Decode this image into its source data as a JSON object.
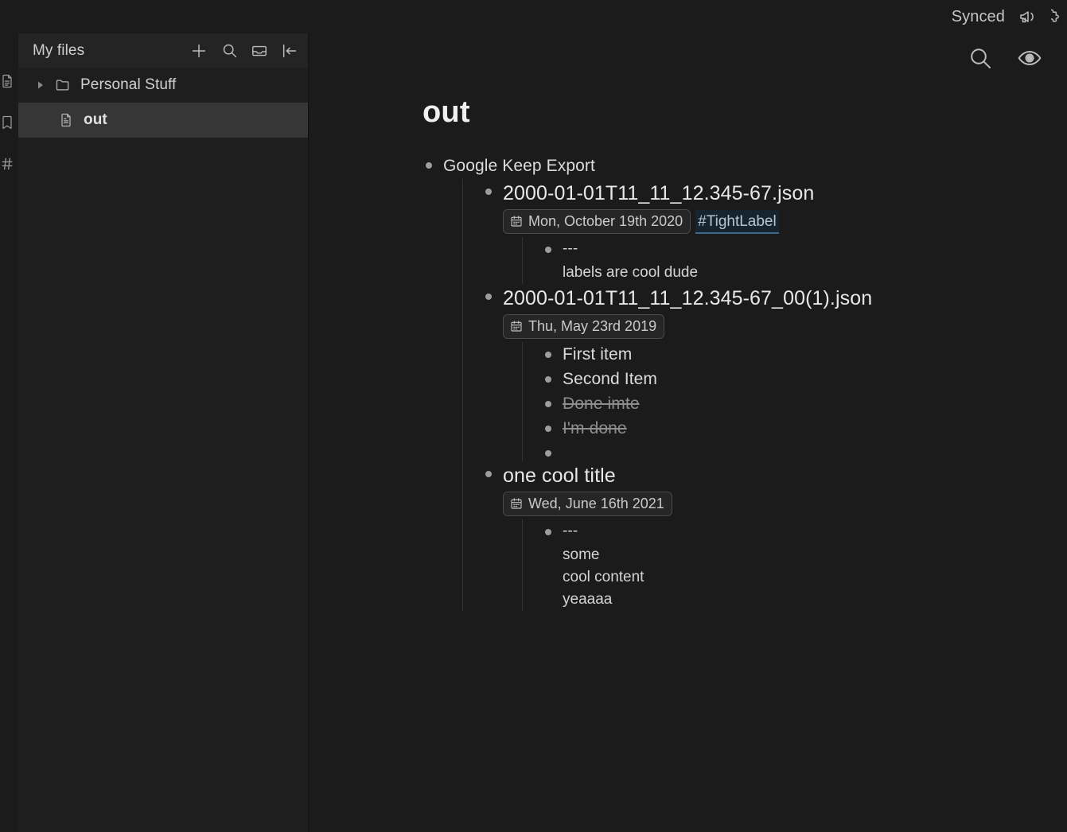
{
  "titlebar": {
    "sync_status": "Synced",
    "announcement_icon": "megaphone-icon",
    "edge_icon": "puzzle-icon"
  },
  "ribbon": {
    "items": [
      {
        "icon": "file-document-icon",
        "name": "files"
      },
      {
        "icon": "bookmark-icon",
        "name": "bookmarks"
      },
      {
        "icon": "hash-tag-icon",
        "name": "tags"
      }
    ]
  },
  "sidebar": {
    "title": "My files",
    "actions": [
      {
        "icon": "plus-icon",
        "label": "New note"
      },
      {
        "icon": "search-icon",
        "label": "Search"
      },
      {
        "icon": "archive-tray-icon",
        "label": "Archive"
      },
      {
        "icon": "collapse-sidebar-icon",
        "label": "Collapse"
      }
    ],
    "tree": [
      {
        "type": "folder",
        "label": "Personal Stuff",
        "expanded": false,
        "active": false
      },
      {
        "type": "file",
        "label": "out",
        "active": true
      }
    ]
  },
  "main": {
    "toolbar": [
      {
        "icon": "search-icon",
        "label": "Search in file"
      },
      {
        "icon": "eye-icon",
        "label": "Reading view"
      }
    ],
    "doc_title": "out",
    "outline": {
      "root_label": "Google Keep Export",
      "notes": [
        {
          "title": "2000-01-01T11_11_12.345-67.json",
          "date": "Mon, October 19th 2020",
          "tag": "#TightLabel",
          "items": [
            {
              "text": "---",
              "done": false
            }
          ],
          "body_lines": [
            "labels are cool dude"
          ]
        },
        {
          "title": "2000-01-01T11_11_12.345-67_00(1).json",
          "date": "Thu, May 23rd 2019",
          "tag": "",
          "items": [
            {
              "text": "First item",
              "done": false
            },
            {
              "text": "Second Item",
              "done": false
            },
            {
              "text": "Done imte",
              "done": true
            },
            {
              "text": "I'm  done",
              "done": true
            },
            {
              "text": "",
              "done": false
            }
          ],
          "body_lines": []
        },
        {
          "title": "one cool title",
          "date": "Wed, June 16th 2021",
          "tag": "",
          "items": [
            {
              "text": "---",
              "done": false
            }
          ],
          "body_lines": [
            "some",
            "cool content",
            "yeaaaa"
          ]
        }
      ]
    }
  },
  "colors": {
    "background": "#1b1b1b",
    "sidebar_background": "#1e1e1e",
    "active_row": "#363636",
    "tag_background": "#16242f",
    "tag_text": "#b4c6d3",
    "tag_underline": "#3d6a8c",
    "text_primary": "#dcdcdc",
    "text_muted": "#8d8d8d"
  }
}
